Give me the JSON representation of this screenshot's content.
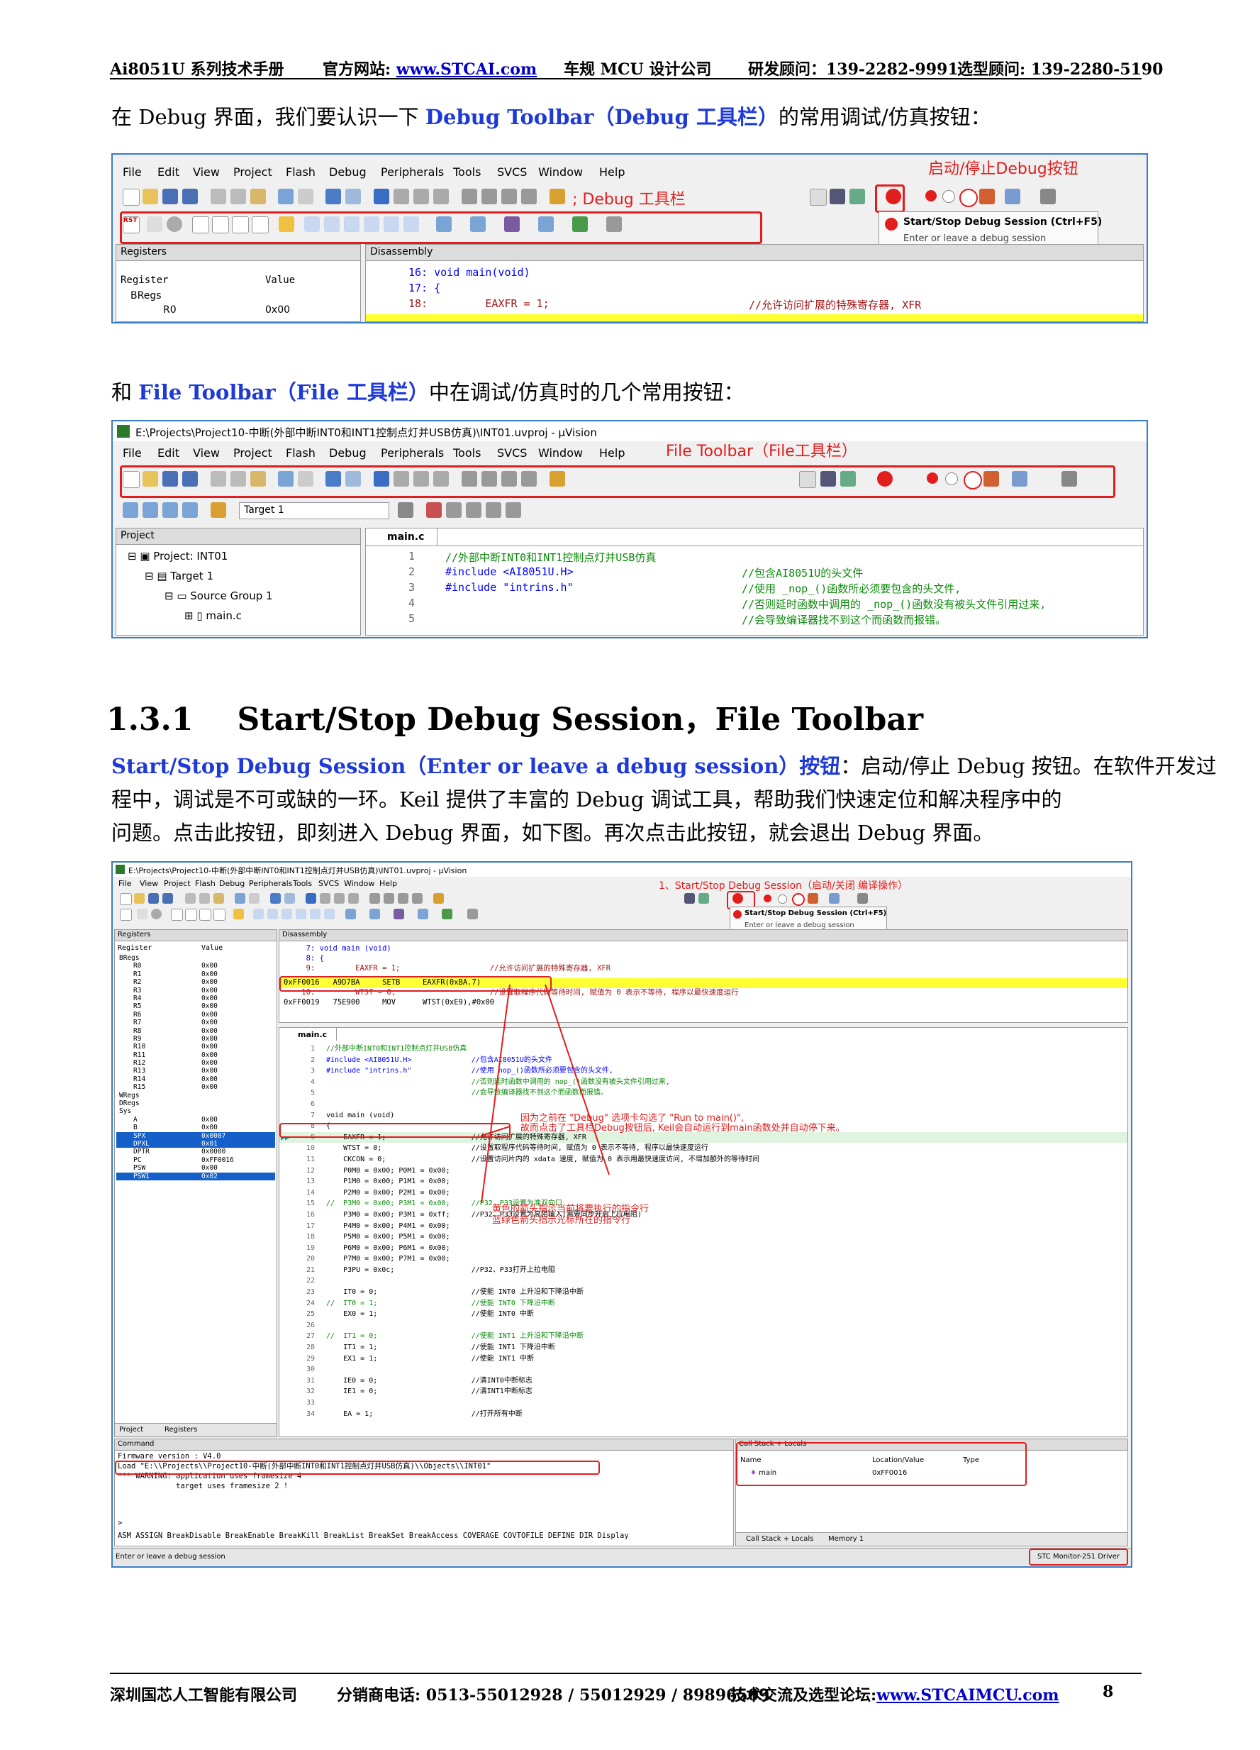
{
  "header": {
    "manual": "Ai8051U 系列技术手册",
    "site_label": "官方网站: ",
    "site_url": "www.STCAI.com",
    "company": "车规 MCU 设计公司",
    "rd": "研发顾问：139-2282-9991",
    "sel": "选型顾问: 139-2280-5190"
  },
  "intro1": {
    "p1": "在 Debug 界面，我们要认识一下 ",
    "p2": "Debug Toolbar（Debug 工具栏）",
    "p3": "的常用调试/仿真按钮："
  },
  "shot1": {
    "menu": [
      "File",
      "Edit",
      "View",
      "Project",
      "Flash",
      "Debug",
      "Peripherals",
      "Tools",
      "SVCS",
      "Window",
      "Help"
    ],
    "debug_toolbar_label": "; Debug 工具栏",
    "start_stop_label": "启动/停止Debug按钮",
    "tooltip_title": "Start/Stop Debug Session (Ctrl+F5)",
    "tooltip_sub": "Enter or leave a debug session",
    "registers_title": "Registers",
    "disassembly_title": "Disassembly",
    "reg_col1": "Register",
    "reg_col2": "Value",
    "reg_group": "BRegs",
    "reg_r0": "R0",
    "reg_r0_val": "0x00",
    "line16": "16: void main(void)",
    "line17": "17: {",
    "line18": "18:         EAXFR = 1;",
    "line18c": "//允许访问扩展的特殊寄存器, XFR",
    "rst": "RST"
  },
  "intro2": {
    "p1": "和 ",
    "p2": "File Toolbar（File 工具栏）",
    "p3": "中在调试/仿真时的几个常用按钮："
  },
  "shot2": {
    "title": "E:\\Projects\\Project10-中断(外部中断INT0和INT1控制点灯并USB仿真)\\INT01.uvproj - µVision",
    "menu": [
      "File",
      "Edit",
      "View",
      "Project",
      "Flash",
      "Debug",
      "Peripherals",
      "Tools",
      "SVCS",
      "Window",
      "Help"
    ],
    "file_toolbar_label": "File Toolbar（File工具栏）",
    "target": "Target 1",
    "project_title": "Project",
    "tree": [
      "Project: INT01",
      "Target 1",
      "Source Group 1",
      "main.c"
    ],
    "tab": "main.c",
    "lines": [
      {
        "n": "1",
        "code": "//外部中断INT0和INT1控制点灯并USB仿真",
        "cmt": ""
      },
      {
        "n": "2",
        "code": "#include <AI8051U.H>",
        "cmt": "//包含AI8051U的头文件"
      },
      {
        "n": "3",
        "code": "#include \"intrins.h\"",
        "cmt": "//使用 _nop_()函数所必须要包含的头文件,"
      },
      {
        "n": "4",
        "code": "",
        "cmt": "//否则延时函数中调用的 _nop_()函数没有被头文件引用过来,"
      },
      {
        "n": "5",
        "code": "",
        "cmt": "//会导致编译器找不到这个而函数而报错。"
      }
    ]
  },
  "section": {
    "num": "1.3.1",
    "title": "Start/Stop Debug Session，File Toolbar"
  },
  "body": {
    "l1a": "Start/Stop Debug Session（Enter or leave a debug session）按钮",
    "l1b": "：启动/停止 Debug 按钮。在软件开发过",
    "l2": "程中，调试是不可或缺的一环。Keil 提供了丰富的 Debug 调试工具，帮助我们快速定位和解决程序中的",
    "l3": "问题。点击此按钮，即刻进入 Debug 界面，如下图。再次点击此按钮，就会退出 Debug 界面。"
  },
  "shot3": {
    "title": "E:\\Projects\\Project10-中断(外部中断INT0和INT1控制点灯并USB仿真)\\INT01.uvproj - µVision",
    "menu": [
      "File",
      "View",
      "Project",
      "Flash",
      "Debug",
      "Peripherals",
      "Tools",
      "SVCS",
      "Window",
      "Help"
    ],
    "note1": "1、Start/Stop Debug Session（启动/关闭 编译操作）",
    "tooltip_title": "Start/Stop Debug Session (Ctrl+F5)",
    "tooltip_sub": "Enter or leave a debug session",
    "registers_title": "Registers",
    "disassembly_title": "Disassembly",
    "reg_head": [
      "Register",
      "Value"
    ],
    "regs": [
      [
        "BRegs",
        ""
      ],
      [
        "R0",
        "0x00"
      ],
      [
        "R1",
        "0x00"
      ],
      [
        "R2",
        "0x00"
      ],
      [
        "R3",
        "0x00"
      ],
      [
        "R4",
        "0x00"
      ],
      [
        "R5",
        "0x00"
      ],
      [
        "R6",
        "0x00"
      ],
      [
        "R7",
        "0x00"
      ],
      [
        "R8",
        "0x00"
      ],
      [
        "R9",
        "0x00"
      ],
      [
        "R10",
        "0x00"
      ],
      [
        "R11",
        "0x00"
      ],
      [
        "R12",
        "0x00"
      ],
      [
        "R13",
        "0x00"
      ],
      [
        "R14",
        "0x00"
      ],
      [
        "R15",
        "0x00"
      ],
      [
        "WRegs",
        ""
      ],
      [
        "DRegs",
        ""
      ],
      [
        "Sys",
        ""
      ],
      [
        "A",
        "0x00"
      ],
      [
        "B",
        "0x00"
      ],
      [
        "SPX",
        "0x0007"
      ],
      [
        "DPXL",
        "0x01"
      ],
      [
        "DPTR",
        "0x0000"
      ],
      [
        "PC",
        "0xFF0016"
      ],
      [
        "PSW",
        "0x00"
      ],
      [
        "PSW1",
        "0x02"
      ]
    ],
    "dis": [
      "     7: void main (void)",
      "     8: {",
      "     9:         EAXFR = 1;                    //允许访问扩展的特殊寄存器, XFR",
      "0xFF0016   A9D7BA     SETB     EAXFR(0xBA.7)",
      "    10:         WTST = 0;                     //设置取程序代码等待时间, 赋值为 0 表示不等待, 程序以最快速度运行",
      "0xFF0019   75E900     MOV      WTST(0xE9),#0x00"
    ],
    "tab": "main.c",
    "src": [
      [
        "1",
        "//外部中断INT0和INT1控制点灯并USB仿真"
      ],
      [
        "2",
        "#include <AI8051U.H>              //包含AI8051U的头文件"
      ],
      [
        "3",
        "#include \"intrins.h\"              //使用 nop_()函数所必须要包含的头文件,"
      ],
      [
        "4",
        "                                  //否则延时函数中调用的 nop_()函数没有被头文件引用过来,"
      ],
      [
        "5",
        "                                  //会导致编译器找不到这个而函数而报错。"
      ],
      [
        "6",
        ""
      ],
      [
        "7",
        "void main (void)"
      ],
      [
        "8",
        "{"
      ],
      [
        "9",
        "    EAXFR = 1;                    //允许访问扩展的特殊寄存器, XFR"
      ],
      [
        "10",
        "    WTST = 0;                     //设置取程序代码等待时间, 赋值为 0 表示不等待, 程序以最快速度运行"
      ],
      [
        "11",
        "    CKCON = 0;                    //设置访问片内的 xdata 速度, 赋值为 0 表示用最快速度访问, 不增加额外的等待时间"
      ],
      [
        "12",
        "    P0M0 = 0x00; P0M1 = 0x00;"
      ],
      [
        "13",
        "    P1M0 = 0x00; P1M1 = 0x00;"
      ],
      [
        "14",
        "    P2M0 = 0x00; P2M1 = 0x00;"
      ],
      [
        "15",
        "//  P3M0 = 0x00; P3M1 = 0x00;     //P32、P33设置为准双向口"
      ],
      [
        "16",
        "    P3M0 = 0x00; P3M1 = 0xff;     //P32、P33设置为高阻输入(需要同步开启上拉电阻)"
      ],
      [
        "17",
        "    P4M0 = 0x00; P4M1 = 0x00;"
      ],
      [
        "18",
        "    P5M0 = 0x00; P5M1 = 0x00;"
      ],
      [
        "19",
        "    P6M0 = 0x00; P6M1 = 0x00;"
      ],
      [
        "20",
        "    P7M0 = 0x00; P7M1 = 0x00;"
      ],
      [
        "21",
        "    P3PU = 0x0c;                  //P32、P33打开上拉电阻"
      ],
      [
        "22",
        ""
      ],
      [
        "23",
        "    IT0 = 0;                      //使能 INT0 上升沿和下降沿中断"
      ],
      [
        "24",
        "//  IT0 = 1;                      //使能 INT0 下降沿中断"
      ],
      [
        "25",
        "    EX0 = 1;                      //使能 INT0 中断"
      ],
      [
        "26",
        ""
      ],
      [
        "27",
        "//  IT1 = 0;                      //使能 INT1 上升沿和下降沿中断"
      ],
      [
        "28",
        "    IT1 = 1;                      //使能 INT1 下降沿中断"
      ],
      [
        "29",
        "    EX1 = 1;                      //使能 INT1 中断"
      ],
      [
        "30",
        ""
      ],
      [
        "31",
        "    IE0 = 0;                      //清INT0中断标志"
      ],
      [
        "32",
        "    IE1 = 0;                      //清INT1中断标志"
      ],
      [
        "33",
        ""
      ],
      [
        "34",
        "    EA = 1;                       //打开所有中断"
      ]
    ],
    "ann1": "因为之前在 \"Debug\" 选项卡勾选了 \"Run to main()\",",
    "ann2": "故而点击了工具栏Debug按钮后, Keil会自动运行到main函数处并自动停下来。",
    "ann3": "黄色的箭头指示当前将要执行的指令行",
    "ann4": "蓝绿色箭头指示光标所在的指令行",
    "proj_tab": "Project",
    "reg_tab": "Registers",
    "cmd_title": "Command",
    "cmd": [
      "Firmware version : V4.0",
      "Load \"E:\\\\Projects\\\\Project10-中断(外部中断INT0和INT1控制点灯并USB仿真)\\\\Objects\\\\INT01\"",
      "*** WARNING: application uses framesize 4",
      "             target uses framesize 2 !"
    ],
    "cmd_prompt": ">",
    "cmd_help": "ASM ASSIGN BreakDisable BreakEnable BreakKill BreakList BreakSet BreakAccess COVERAGE COVTOFILE DEFINE DIR Display",
    "status": "Enter or leave a debug session",
    "callstack_title": "Call Stack + Locals",
    "cs_head": [
      "Name",
      "Location/Value",
      "Type"
    ],
    "cs_row": [
      "main",
      "0xFF0016",
      ""
    ],
    "cs_tab1": "Call Stack + Locals",
    "cs_tab2": "Memory 1",
    "driver": "STC Monitor-251 Driver"
  },
  "footer": {
    "company": "深圳国芯人工智能有限公司",
    "phone": "分销商电话: 0513-55012928 / 55012929 / 89896509",
    "forum_label": "技术交流及选型论坛:",
    "forum_url": "www.STCAIMCU.com",
    "page": "8"
  },
  "colors": {
    "accent_blue": "#1e3ad6",
    "annotation_red": "#e21d1d",
    "highlight_yellow": "#ffff33"
  }
}
